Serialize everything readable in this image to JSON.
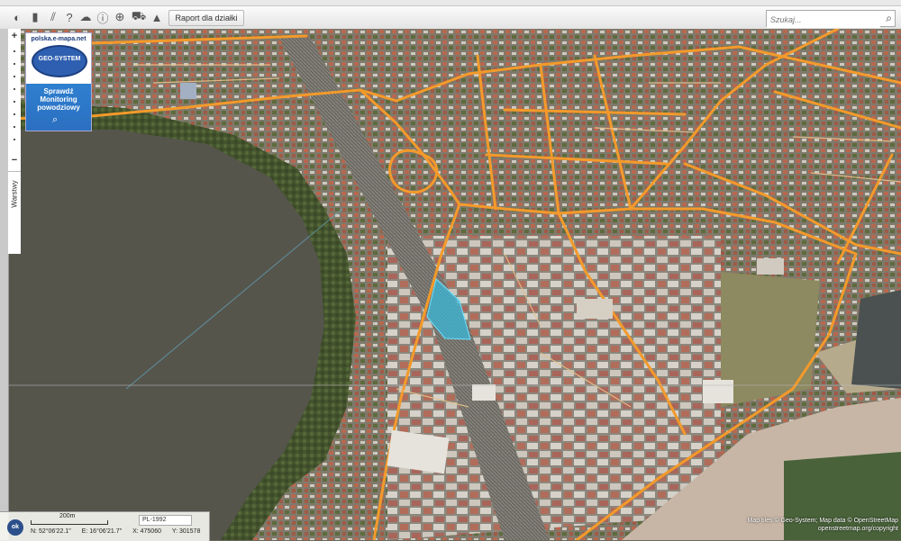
{
  "toolbar": {
    "icons": [
      "globe-icon",
      "chat-icon",
      "slashes-icon",
      "help-icon",
      "cloud-icon",
      "zoom-tool-icon",
      "cart-icon",
      "warning-icon"
    ],
    "report_label": "Raport dla działki",
    "search_placeholder": "Szukaj..."
  },
  "sidebar": {
    "zoom_in": "+",
    "zoom_out": "−",
    "layers_label": "Warstwy"
  },
  "brand": {
    "url": "polska.e-mapa.net",
    "logo_text": "GEO-SYSTEM",
    "promo_line1": "Sprawdź",
    "promo_line2": "Monitoring",
    "promo_line3": "powodziowy"
  },
  "status": {
    "ok_label": "ok",
    "scale_label": "200m",
    "projection": "PL-1992",
    "lat": "N: 52°06'22.1\"",
    "lon": "E: 16°06'21.7\"",
    "x": "X: 475060",
    "y": "Y: 301578"
  },
  "attribution": {
    "line1": "Map tiles © Geo-System; Map data © OpenStreetMap",
    "line2": "openstreetmap.org/copyright"
  },
  "colors": {
    "road": "#f39a2b",
    "lake": "#55554c",
    "parcel": "#3ab7d8"
  }
}
